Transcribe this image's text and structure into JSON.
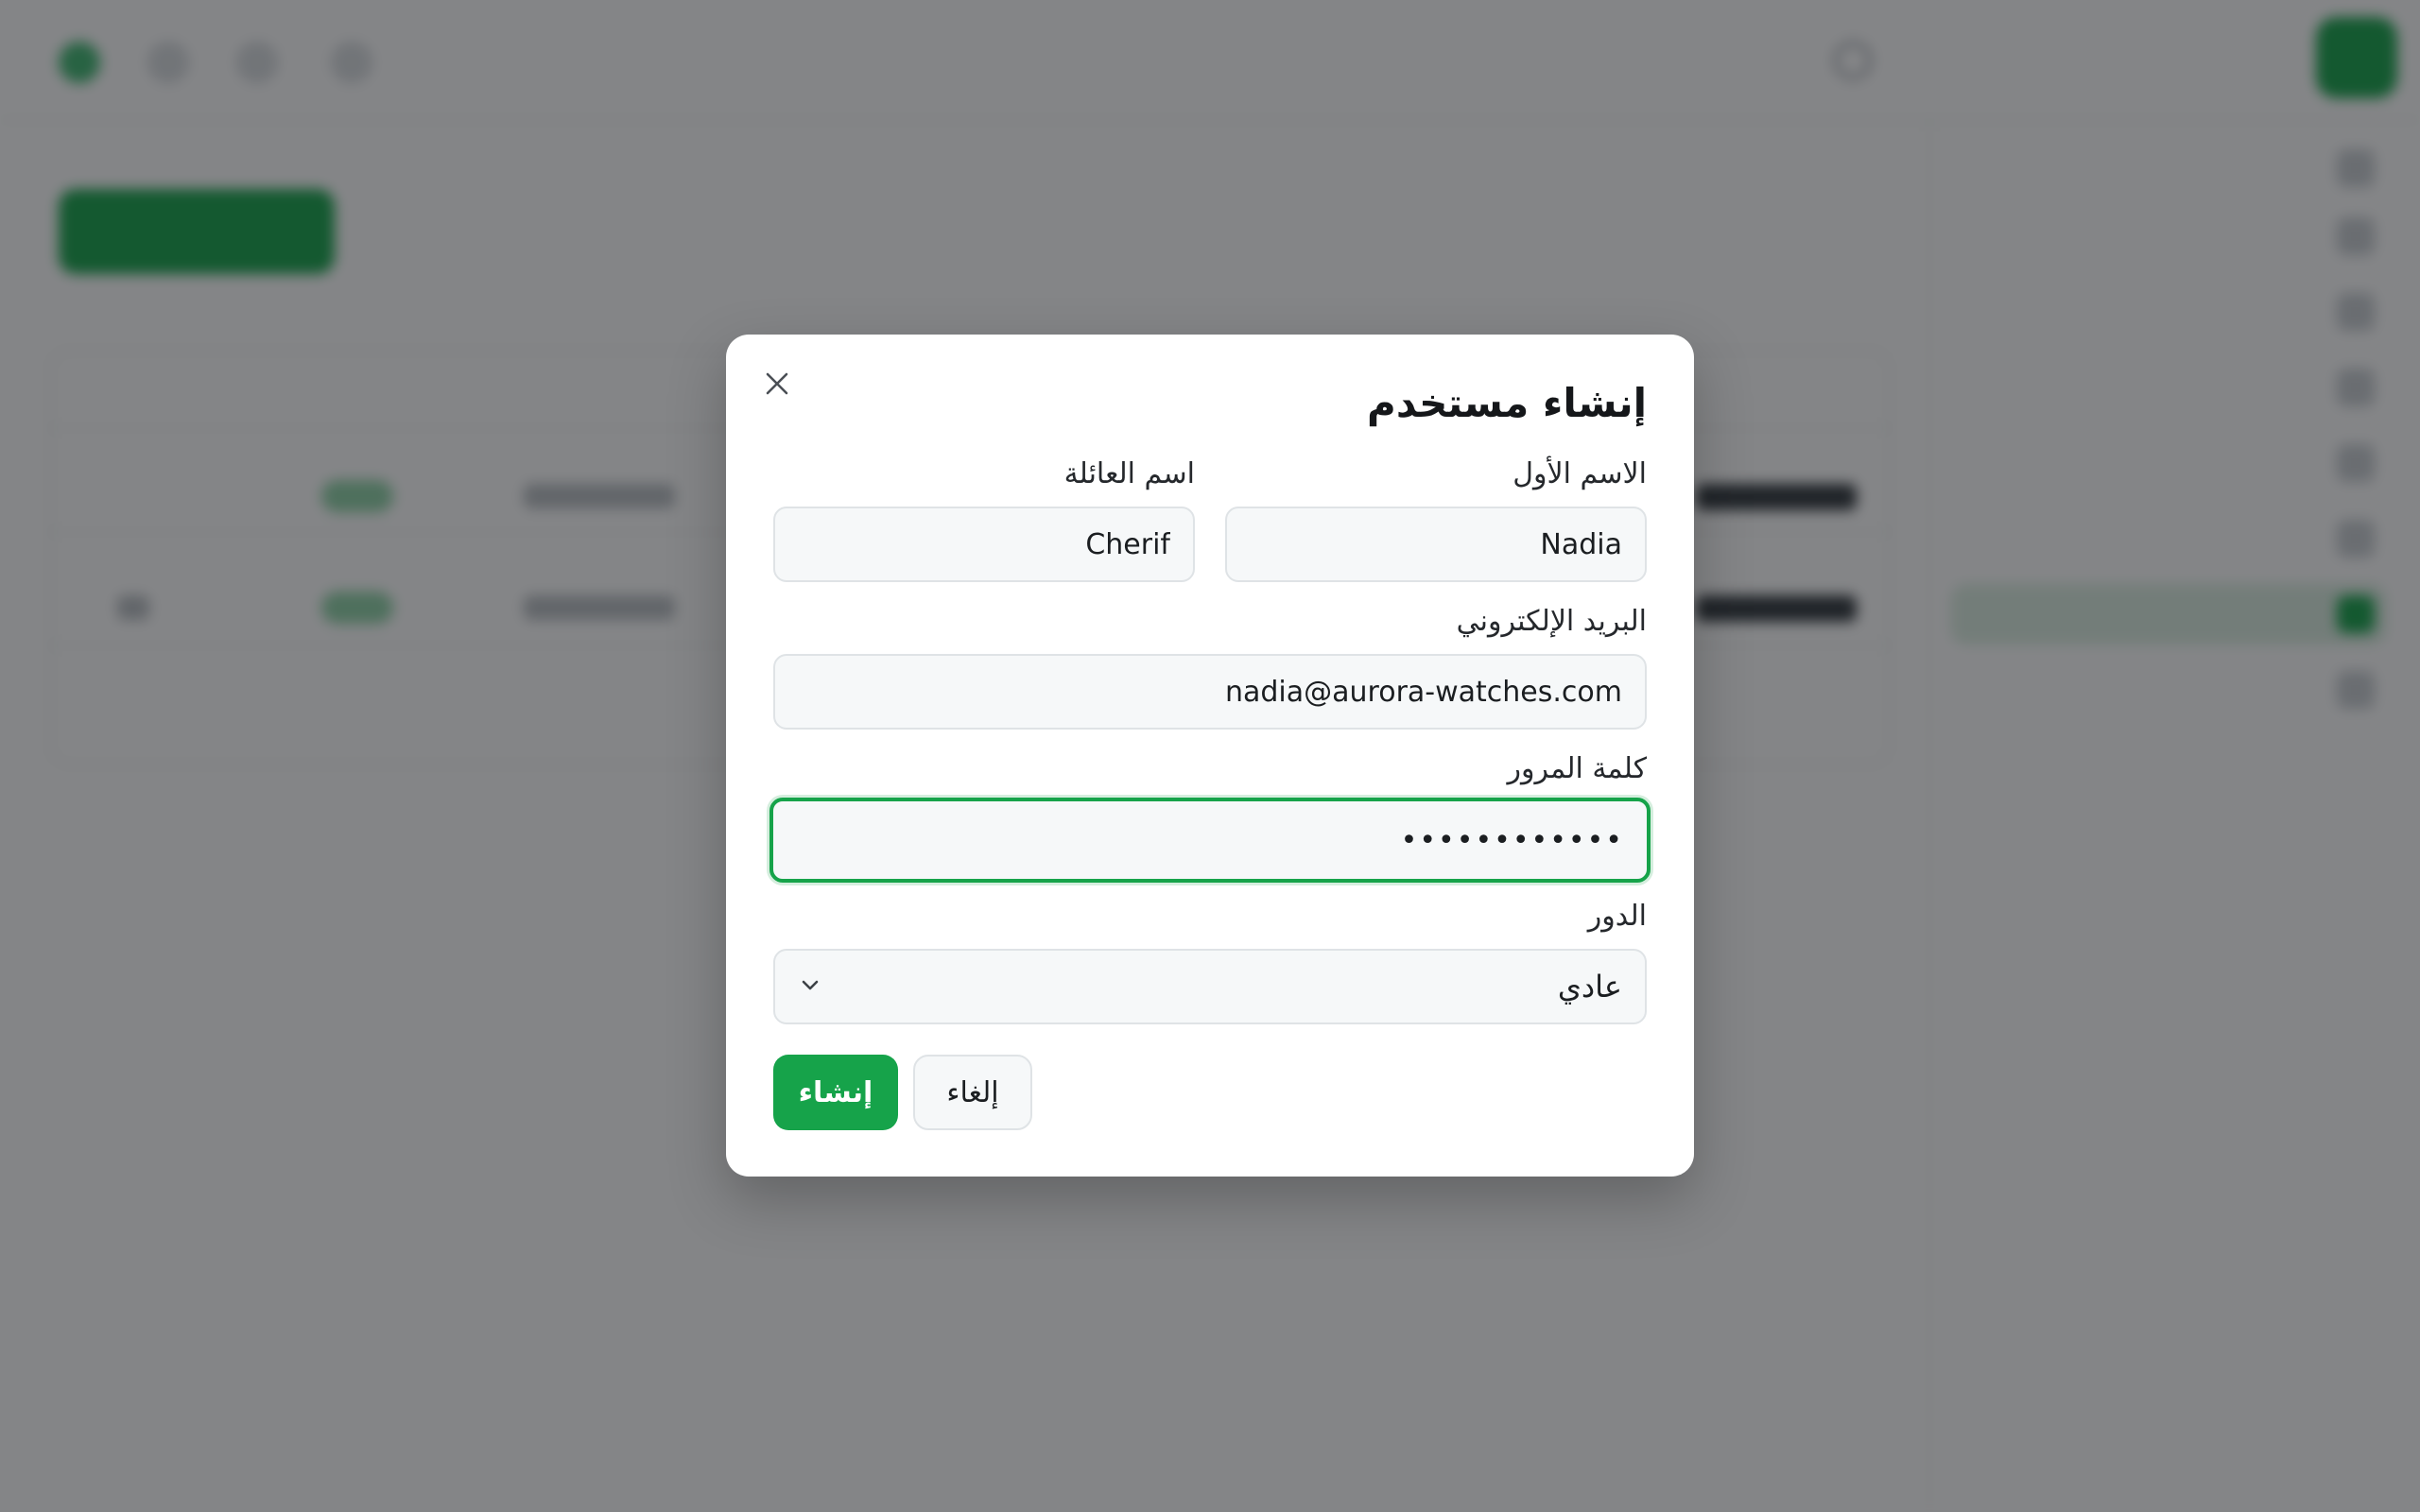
{
  "modal": {
    "title": "إنشاء مستخدم",
    "first_name": {
      "label": "الاسم الأول",
      "value": "Nadia"
    },
    "last_name": {
      "label": "اسم العائلة",
      "value": "Cherif"
    },
    "email": {
      "label": "البريد الإلكتروني",
      "value": "nadia@aurora-watches.com"
    },
    "password": {
      "label": "كلمة المرور",
      "value": "••••••••••••"
    },
    "role": {
      "label": "الدور",
      "selected": "عادي"
    },
    "buttons": {
      "create": "إنشاء",
      "cancel": "إلغاء"
    }
  },
  "colors": {
    "accent": "#16a34a",
    "overlay": "rgba(20,22,24,0.52)"
  }
}
